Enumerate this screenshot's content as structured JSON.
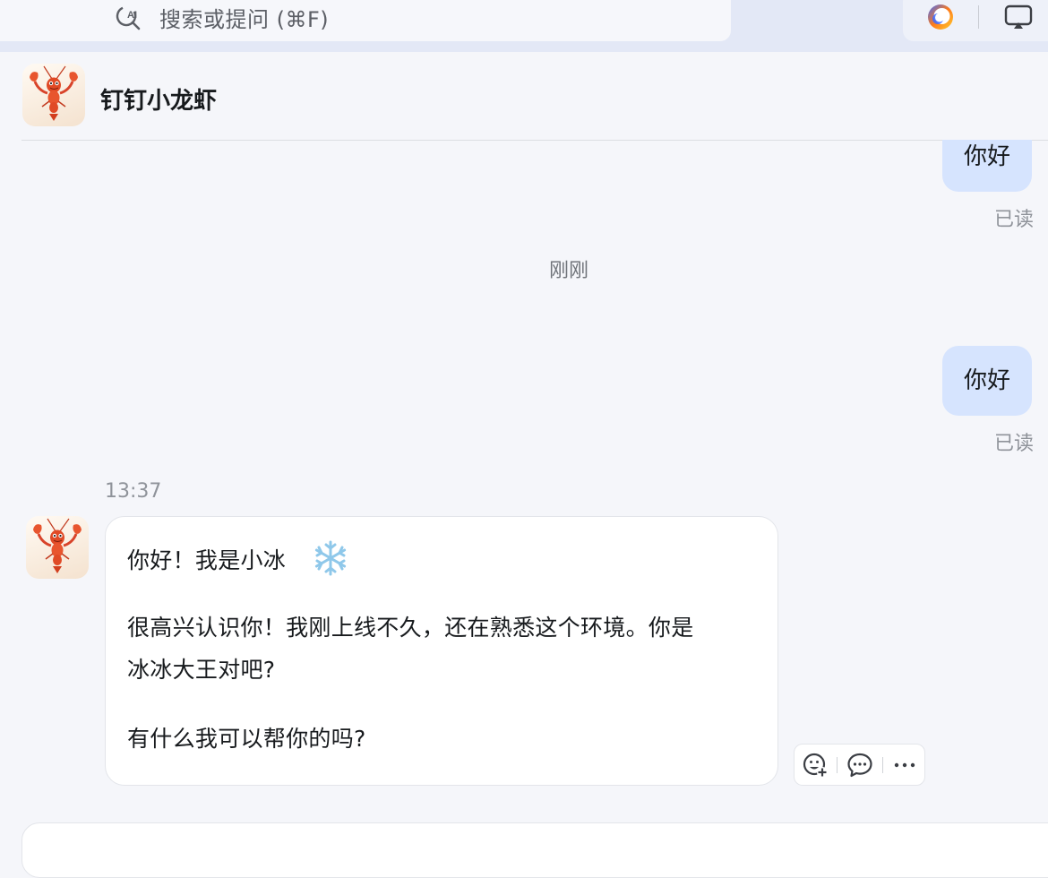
{
  "top_bar": {
    "search_placeholder": "搜索或提问 (⌘F)",
    "search_icon": "ai-search-icon",
    "assistant_icon": "ai-assistant-orb-icon",
    "screen_icon": "screen-share-icon"
  },
  "chat": {
    "title": "钉钉小龙虾",
    "avatar": "lobster-avatar",
    "messages_out": [
      {
        "text": "你好",
        "status": "已读"
      },
      {
        "text": "你好",
        "status": "已读"
      }
    ],
    "time_separator": "刚刚",
    "incoming": {
      "timestamp": "13:37",
      "lines": [
        "你好！我是小冰",
        "很高兴认识你！我刚上线不久，还在熟悉这个环境。你是",
        "冰冰大王对吧?",
        "有什么我可以帮你的吗?"
      ],
      "emoji": "snowflake-emoji"
    },
    "actions": {
      "emoji": "add-reaction-icon",
      "reply": "comment-icon",
      "more": "more-dots-icon"
    }
  },
  "colors": {
    "accent_bubble": "#d6e4fe",
    "background": "#f5f6fa",
    "topbar": "#e3e8f6"
  }
}
